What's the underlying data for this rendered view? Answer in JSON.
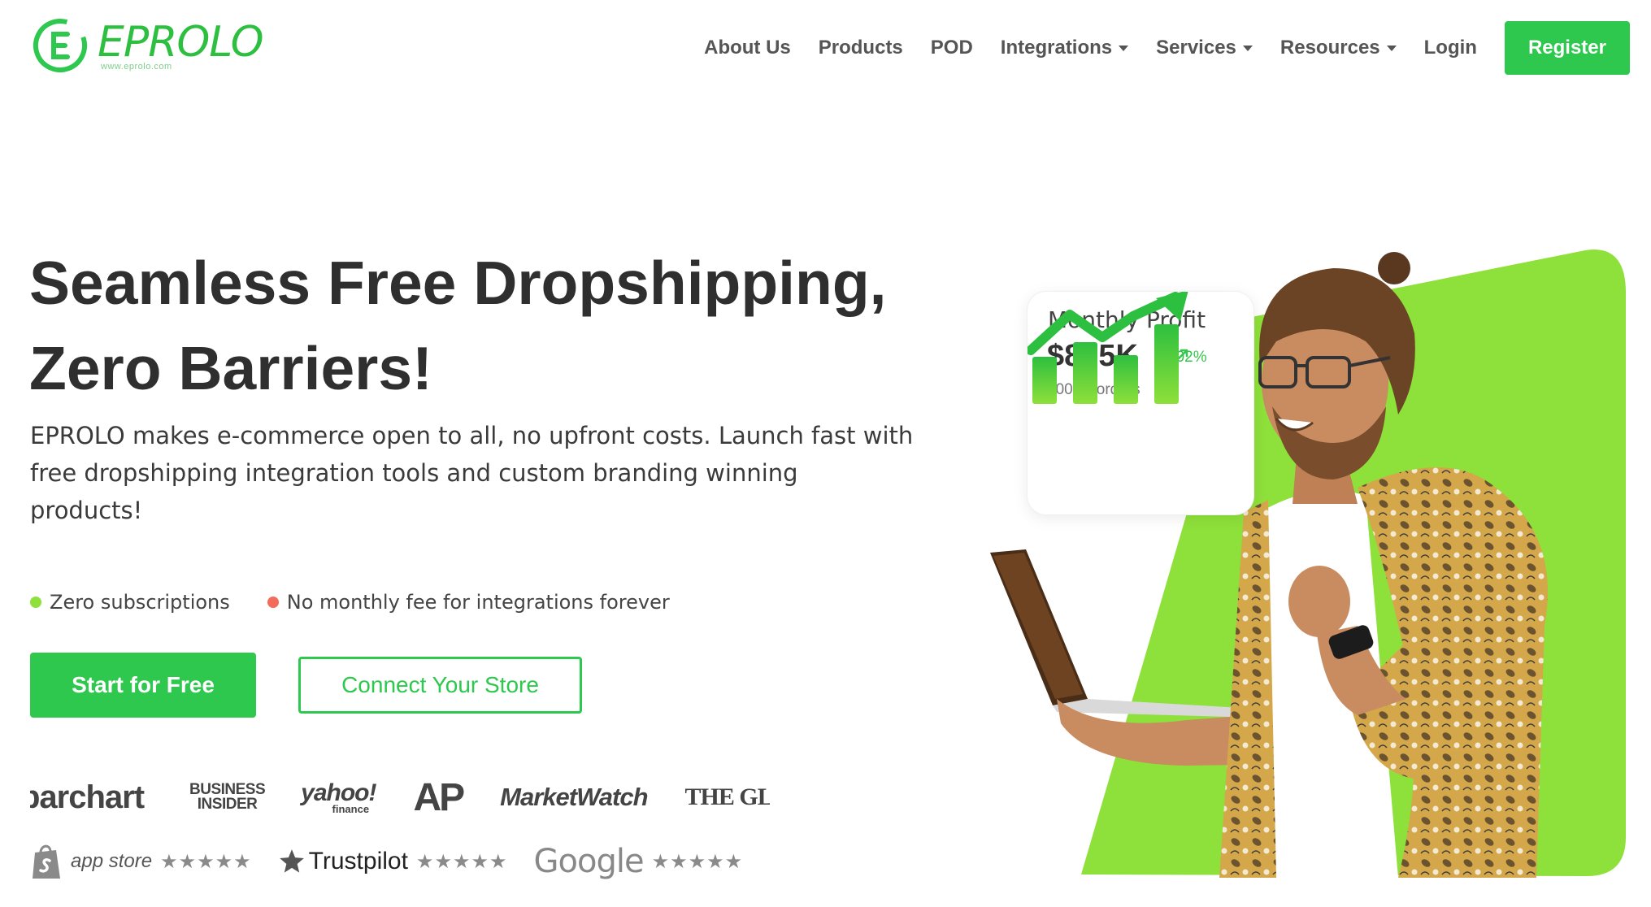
{
  "brand": {
    "name": "EPROLO",
    "url": "www.eprolo.com",
    "color": "#2dc84d"
  },
  "nav": {
    "items": [
      {
        "label": "About Us",
        "dropdown": false
      },
      {
        "label": "Products",
        "dropdown": false
      },
      {
        "label": "POD",
        "dropdown": false
      },
      {
        "label": "Integrations",
        "dropdown": true
      },
      {
        "label": "Services",
        "dropdown": true
      },
      {
        "label": "Resources",
        "dropdown": true
      },
      {
        "label": "Login",
        "dropdown": false
      }
    ],
    "register_label": "Register"
  },
  "hero": {
    "title_line1": "Seamless Free Dropshipping,",
    "title_line2": "Zero Barriers!",
    "description": "EPROLO makes e-commerce open to all, no upfront costs. Launch fast with free dropshipping integration tools and custom branding winning products!",
    "features": [
      {
        "label": "Zero subscriptions",
        "dot_color": "#8ee03a"
      },
      {
        "label": "No monthly fee for integrations forever",
        "dot_color": "#f26b5b"
      }
    ],
    "primary_cta": "Start for Free",
    "secondary_cta": "Connect Your Store"
  },
  "press": {
    "barchart": "barchart",
    "business_insider_line1": "BUSINESS",
    "business_insider_line2": "INSIDER",
    "yahoo": "yahoo!",
    "yahoo_sub": "finance",
    "ap": "AP",
    "marketwatch": "MarketWatch",
    "globe": "THE GLOBE"
  },
  "reviews": [
    {
      "platform": "app store",
      "stars": "★★★★★",
      "icon": "shopify-bag-icon"
    },
    {
      "platform": "Trustpilot",
      "stars": "★★★★★",
      "icon": "trustpilot-star-icon"
    },
    {
      "platform": "Google",
      "stars": "★★★★★",
      "icon": "google-wordmark"
    }
  ],
  "profit_card": {
    "title": "Monthly Profit",
    "value": "$875K",
    "change": "102%",
    "orders": "100K+ orders",
    "accent": "#35c64b"
  },
  "colors": {
    "accent": "#2dc84d",
    "lime": "#8ee03a",
    "heading": "#2f2f2f"
  }
}
